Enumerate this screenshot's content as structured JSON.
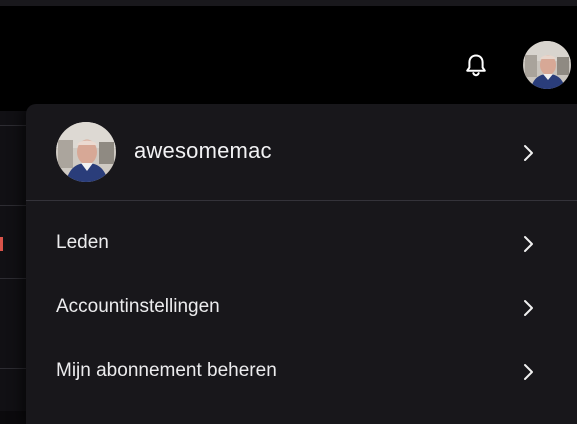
{
  "header": {
    "notifications_icon": "bell-icon",
    "avatar_icon": "user-avatar"
  },
  "profile_menu": {
    "username": "awesomemac",
    "items": [
      {
        "label": "Leden"
      },
      {
        "label": "Accountinstellingen"
      },
      {
        "label": "Mijn abonnement beheren"
      }
    ]
  },
  "colors": {
    "menu_bg": "#18171b",
    "header_bg": "#000000",
    "text": "#ececee",
    "accent_left": "#d9534a"
  }
}
